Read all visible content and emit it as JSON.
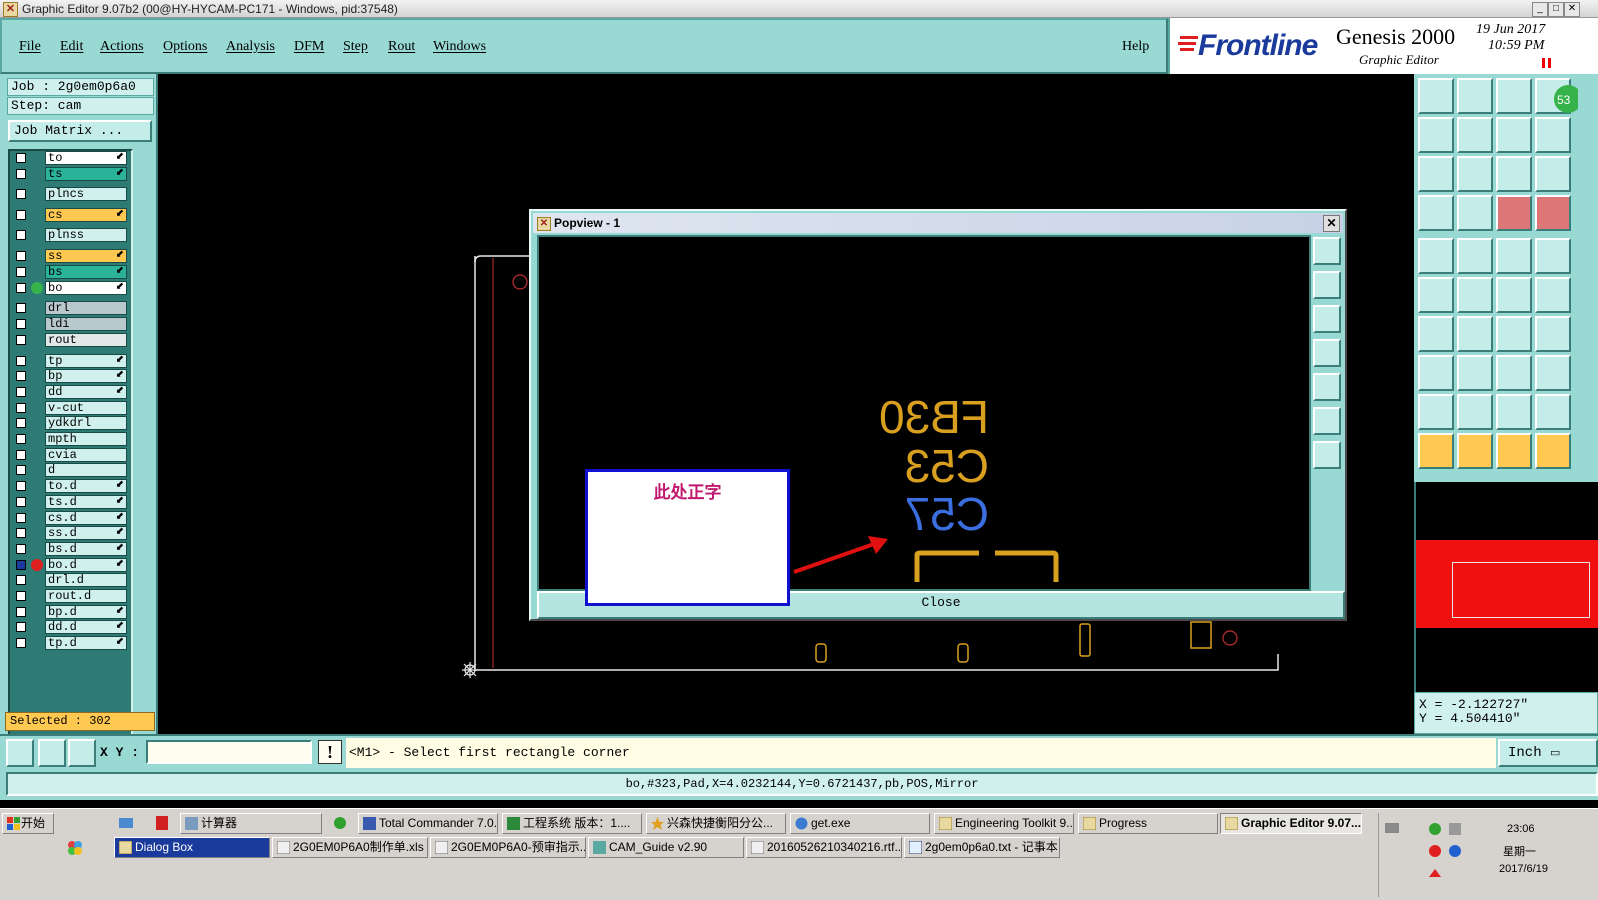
{
  "window": {
    "title": "Graphic Editor 9.07b2 (00@HY-HYCAM-PC171 - Windows, pid:37548)"
  },
  "menu": {
    "items": [
      "File",
      "Edit",
      "Actions",
      "Options",
      "Analysis",
      "DFM",
      "Step",
      "Rout",
      "Windows"
    ],
    "help": "Help"
  },
  "brand": {
    "logo": "Frontline",
    "product": "Genesis 2000",
    "subtitle": "Graphic Editor",
    "date": "19  Jun  2017",
    "time": "10:59  PM",
    "badge": "53"
  },
  "job": {
    "job_label": "Job : 2g0em0p6a0",
    "step_label": "Step: cam",
    "matrix_button": "Job Matrix ..."
  },
  "layers": [
    {
      "name": "to",
      "color": "#ffffff",
      "arrow": true
    },
    {
      "name": "ts",
      "color": "#2bb39a",
      "arrow": true
    },
    {
      "name": "plncs",
      "color": "#cff0ec",
      "arrow": false
    },
    {
      "name": "cs",
      "color": "#ffc850",
      "arrow": true
    },
    {
      "name": "plnss",
      "color": "#cff0ec",
      "arrow": false
    },
    {
      "name": "ss",
      "color": "#ffc850",
      "arrow": true
    },
    {
      "name": "bs",
      "color": "#2bb39a",
      "arrow": true
    },
    {
      "name": "bo",
      "color": "#ffffff",
      "arrow": true
    },
    {
      "name": "drl",
      "color": "#b8c8cc",
      "arrow": false
    },
    {
      "name": "ldi",
      "color": "#b8c8cc",
      "arrow": false
    },
    {
      "name": "rout",
      "color": "#e0e8e8",
      "arrow": false
    },
    {
      "name": "tp",
      "color": "#cff0ec",
      "arrow": true
    },
    {
      "name": "bp",
      "color": "#cff0ec",
      "arrow": true
    },
    {
      "name": "dd",
      "color": "#cff0ec",
      "arrow": true
    },
    {
      "name": "v-cut",
      "color": "#cff0ec",
      "arrow": false
    },
    {
      "name": "ydkdrl",
      "color": "#cff0ec",
      "arrow": false
    },
    {
      "name": "mpth",
      "color": "#cff0ec",
      "arrow": false
    },
    {
      "name": "cvia",
      "color": "#cff0ec",
      "arrow": false
    },
    {
      "name": "d",
      "color": "#cff0ec",
      "arrow": false
    },
    {
      "name": "to.d",
      "color": "#cff0ec",
      "arrow": true
    },
    {
      "name": "ts.d",
      "color": "#cff0ec",
      "arrow": true
    },
    {
      "name": "cs.d",
      "color": "#cff0ec",
      "arrow": true
    },
    {
      "name": "ss.d",
      "color": "#cff0ec",
      "arrow": true
    },
    {
      "name": "bs.d",
      "color": "#cff0ec",
      "arrow": true
    },
    {
      "name": "bo.d",
      "color": "#cff0ec",
      "arrow": true
    },
    {
      "name": "drl.d",
      "color": "#cff0ec",
      "arrow": false
    },
    {
      "name": "rout.d",
      "color": "#cff0ec",
      "arrow": false
    },
    {
      "name": "bp.d",
      "color": "#cff0ec",
      "arrow": true
    },
    {
      "name": "dd.d",
      "color": "#cff0ec",
      "arrow": true
    },
    {
      "name": "tp.d",
      "color": "#cff0ec",
      "arrow": true
    }
  ],
  "selected": "Selected : 302",
  "popview": {
    "title": "Popview - 1",
    "close_button": "Close",
    "silk_texts": [
      {
        "text": "FB30",
        "color": "#d9a020"
      },
      {
        "text": "C53",
        "color": "#d9a020"
      },
      {
        "text": "C57",
        "color": "#3b6fe0"
      }
    ]
  },
  "annotation": {
    "text": "此处正字",
    "arrow_color": "#e01010",
    "box_border": "#1010d0"
  },
  "coords": {
    "x": "X = -2.122727\"",
    "y": "Y = 4.504410\""
  },
  "command": {
    "xy_label": "X Y :",
    "xy_value": "",
    "prompt": "<M1> - Select first rectangle corner",
    "units": "Inch"
  },
  "status": "bo,#323,Pad,X=4.0232144,Y=0.6721437,pb,POS,Mirror",
  "taskbar": {
    "start": "开始",
    "row1": [
      {
        "label": "计算器",
        "active": false
      },
      {
        "label": "Total Commander 7.0...",
        "active": false
      },
      {
        "label": "工程系统  版本：1....",
        "active": false
      },
      {
        "label": "兴森快捷衡阳分公...",
        "active": false
      },
      {
        "label": "get.exe",
        "active": false
      },
      {
        "label": "Engineering Toolkit 9....",
        "active": false
      },
      {
        "label": "Progress",
        "active": false
      },
      {
        "label": "Graphic Editor 9.07...",
        "active": true
      }
    ],
    "row2": [
      {
        "label": "Dialog Box",
        "active": false
      },
      {
        "label": "2G0EM0P6A0制作单.xls ...",
        "active": false
      },
      {
        "label": "2G0EM0P6A0-预审指示....",
        "active": false
      },
      {
        "label": "CAM_Guide v2.90",
        "active": false
      },
      {
        "label": "20160526210340216.rtf...",
        "active": false
      },
      {
        "label": "2g0em0p6a0.txt - 记事本",
        "active": false
      }
    ],
    "clock_time": "23:06",
    "clock_day": "星期一",
    "clock_date": "2017/6/19"
  }
}
